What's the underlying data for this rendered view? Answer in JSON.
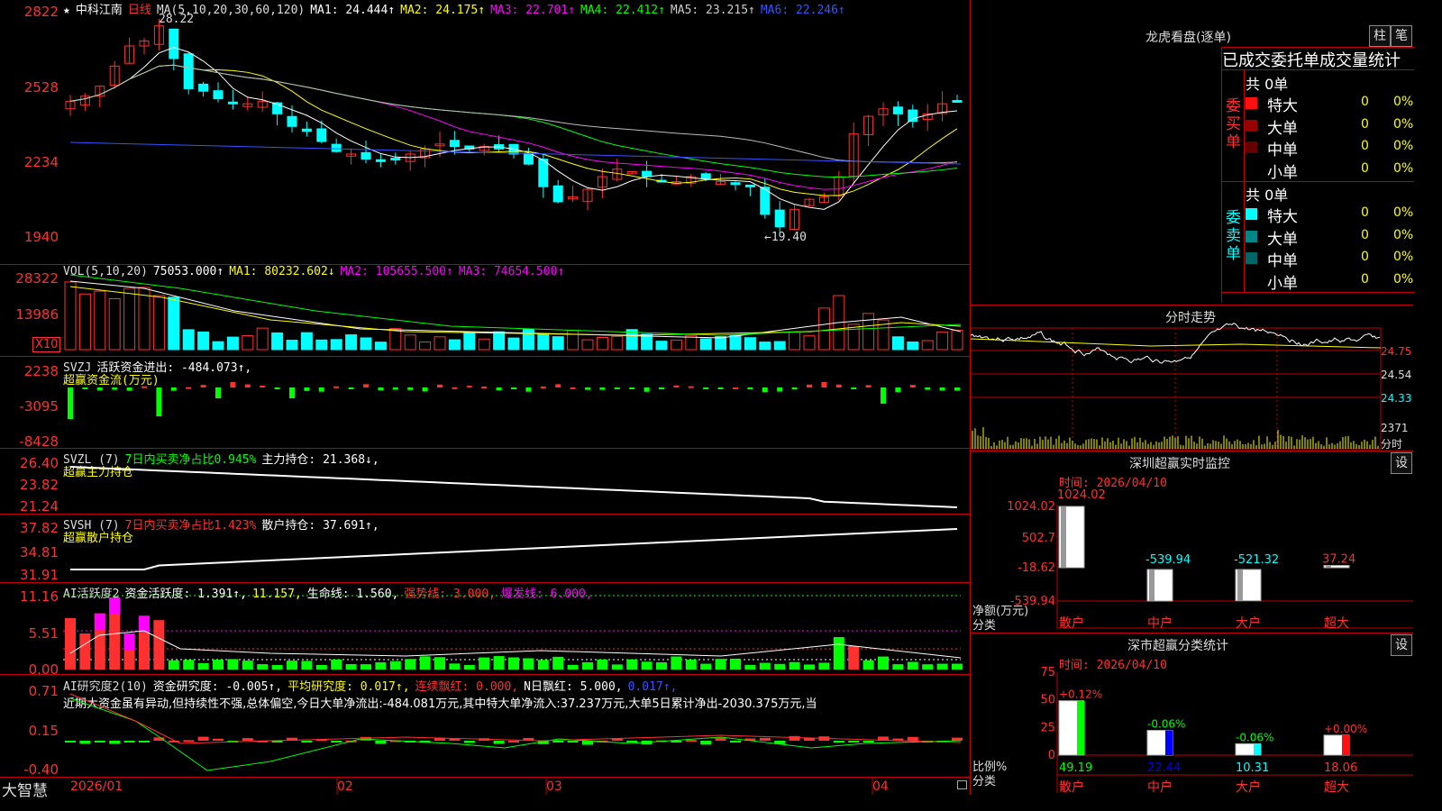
{
  "stock_title": "中科江南",
  "period": "日线",
  "kline": {
    "ma_legend": [
      {
        "label": "MA(5,10,20,30,60,120)",
        "color": "#dddddd"
      },
      {
        "label": "MA1: 24.444↑",
        "color": "#ffffff"
      },
      {
        "label": "MA2: 24.175↑",
        "color": "#ffff00"
      },
      {
        "label": "MA3: 22.701↑",
        "color": "#ff00ff"
      },
      {
        "label": "MA4: 22.412↑",
        "color": "#00ff00"
      },
      {
        "label": "MA5: 23.215↑",
        "color": "#cccccc"
      },
      {
        "label": "MA6: 22.246↑",
        "color": "#3355ff"
      }
    ],
    "y_labels": [
      "2822",
      "2528",
      "2234",
      "1940"
    ],
    "high_note": "28.22",
    "low_note": "←19.40"
  },
  "vol": {
    "legend": [
      {
        "label": "VOL(5,10,20)",
        "color": "#dddddd"
      },
      {
        "label": "75053.000↑",
        "color": "#ffffff"
      },
      {
        "label": "MA1: 80232.602↓",
        "color": "#ffff00"
      },
      {
        "label": "MA2: 105655.500↑",
        "color": "#ff00ff"
      },
      {
        "label": "MA3: 74654.500↑",
        "color": "#ff00ff"
      }
    ],
    "y_labels": [
      "28322",
      "13986"
    ],
    "unit": "X10"
  },
  "svzj": {
    "legend": [
      {
        "label": "SVZJ",
        "color": "#dddddd"
      },
      {
        "label": "活跃资金进出: -484.073↑,",
        "color": "#ffffff"
      }
    ],
    "sub": "超赢资金流(万元)",
    "y_labels": [
      "2238",
      "-3095",
      "-8428"
    ]
  },
  "svzl": {
    "legend": [
      {
        "label": "SVZL (7)",
        "color": "#dddddd"
      },
      {
        "label": "7日内买卖净占比0.945%",
        "color": "#00ff00"
      },
      {
        "label": "主力持仓: 21.368↓,",
        "color": "#ffffff"
      }
    ],
    "sub": "超赢主力持仓",
    "y_labels": [
      "26.40",
      "23.82",
      "21.24"
    ]
  },
  "svsh": {
    "legend": [
      {
        "label": "SVSH (7)",
        "color": "#dddddd"
      },
      {
        "label": "7日内买卖净占比1.423%",
        "color": "#ff3030"
      },
      {
        "label": "散户持仓: 37.691↑,",
        "color": "#ffffff"
      }
    ],
    "sub": "超赢散户持仓",
    "y_labels": [
      "37.82",
      "34.81",
      "31.91"
    ]
  },
  "ai1": {
    "legend": [
      {
        "label": "AI活跃度2",
        "color": "#dddddd"
      },
      {
        "label": "资金活跃度: 1.391↑,",
        "color": "#ffffff"
      },
      {
        "label": "11.157,",
        "color": "#ffff00"
      },
      {
        "label": "生命线: 1.560,",
        "color": "#ffffff"
      },
      {
        "label": "强势线: 3.000,",
        "color": "#ff3030"
      },
      {
        "label": "爆发线: 6.000,",
        "color": "#ff00ff"
      }
    ],
    "y_labels": [
      "11.16",
      "5.51",
      "0.00"
    ]
  },
  "ai2": {
    "legend": [
      {
        "label": "AI研究度2(10)",
        "color": "#dddddd"
      },
      {
        "label": "资金研究度: -0.005↑,",
        "color": "#ffffff"
      },
      {
        "label": "平均研究度: 0.017↑,",
        "color": "#ffff00"
      },
      {
        "label": "连续飘红: 0.000,",
        "color": "#ff3030"
      },
      {
        "label": "N日飘红: 5.000,",
        "color": "#ffffff"
      },
      {
        "label": "0.017↑,",
        "color": "#3355ff"
      }
    ],
    "commentary": "近期大资金虽有异动,但持续性不强,总体偏空,今日大单净流出:-484.081万元,其中特大单净流入:37.237万元,大单5日累计净出-2030.375万元,当",
    "y_labels": [
      "0.71",
      "0.15",
      "-0.40"
    ]
  },
  "x_axis": {
    "logo": "大智慧",
    "labels": [
      "2026/01",
      "02",
      "03",
      "04"
    ]
  },
  "right": {
    "dragon_title": "龙虎看盘(逐单)",
    "btn_bar": "柱",
    "btn_pen": "笔",
    "tabs": [
      "已成交",
      "委托单",
      "成交量统计"
    ],
    "buy": {
      "total": "共 0单",
      "side_label": "委买单",
      "rows": [
        {
          "name": "特大",
          "count": "0",
          "pct": "0%",
          "color": "#ff1010"
        },
        {
          "name": "大单",
          "count": "0",
          "pct": "0%",
          "color": "#990000"
        },
        {
          "name": "中单",
          "count": "0",
          "pct": "0%",
          "color": "#660000"
        },
        {
          "name": "小单",
          "count": "0",
          "pct": "0%",
          "color": "#000000"
        }
      ]
    },
    "sell": {
      "total": "共 0单",
      "side_label": "委卖单",
      "rows": [
        {
          "name": "特大",
          "count": "0",
          "pct": "0%",
          "color": "#00ffff"
        },
        {
          "name": "大单",
          "count": "0",
          "pct": "0%",
          "color": "#008888"
        },
        {
          "name": "中单",
          "count": "0",
          "pct": "0%",
          "color": "#006666"
        },
        {
          "name": "小单",
          "count": "0",
          "pct": "0%",
          "color": "#000000"
        }
      ]
    },
    "intraday": {
      "title": "分时走势",
      "y_labels": [
        "24.75",
        "24.54",
        "24.33",
        "2371"
      ],
      "unit": "分时"
    },
    "monitor": {
      "title": "深圳超赢实时监控",
      "settings": "设",
      "time": "时间: 2026/04/10",
      "y_labels": [
        "1024.02",
        "502.7",
        "-18.62",
        "-539.94"
      ],
      "ylabel": "净额(万元)",
      "xlabel": "分类",
      "categories": [
        "散户",
        "中户",
        "大户",
        "超大"
      ],
      "values": [
        1024.02,
        -539.94,
        -521.32,
        37.24
      ],
      "value_labels": [
        "1024.02",
        "-539.94",
        "-521.32",
        "37.24"
      ]
    },
    "classify": {
      "title": "深市超赢分类统计",
      "settings": "设",
      "time": "时间: 2026/04/10",
      "y_labels": [
        "75",
        "50",
        "25",
        "0"
      ],
      "ylabel": "比例%",
      "xlabel": "分类",
      "categories": [
        "散户",
        "中户",
        "大户",
        "超大"
      ],
      "values": [
        49.19,
        22.44,
        10.31,
        18.06
      ],
      "changes": [
        "+0.12%",
        "-0.06%",
        "-0.06%",
        "+0.00%"
      ],
      "value_labels": [
        "49.19",
        "22.44",
        "10.31",
        "18.06"
      ]
    }
  },
  "chart_data": [
    {
      "type": "bar",
      "title": "深圳超赢实时监控",
      "xlabel": "分类",
      "ylabel": "净额(万元)",
      "categories": [
        "散户",
        "中户",
        "大户",
        "超大"
      ],
      "values": [
        1024.02,
        -539.94,
        -521.32,
        37.24
      ],
      "ylim": [
        -539.94,
        1024.02
      ]
    },
    {
      "type": "bar",
      "title": "深市超赢分类统计",
      "xlabel": "分类",
      "ylabel": "比例%",
      "categories": [
        "散户",
        "中户",
        "大户",
        "超大"
      ],
      "values": [
        49.19,
        22.44,
        10.31,
        18.06
      ],
      "ylim": [
        0,
        75
      ]
    }
  ]
}
